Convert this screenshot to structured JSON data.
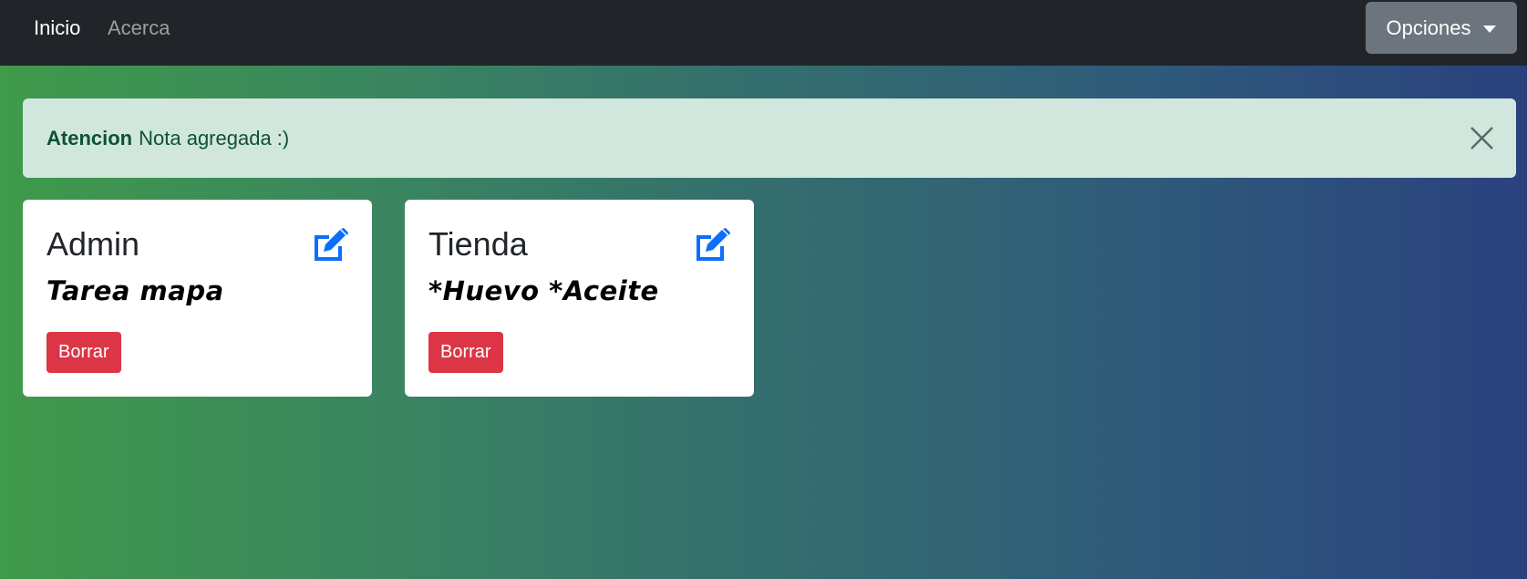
{
  "navbar": {
    "links": [
      {
        "label": "Inicio"
      },
      {
        "label": "Acerca"
      }
    ],
    "options_label": "Opciones"
  },
  "alert": {
    "strong": "Atencion",
    "message": "Nota agregada :)"
  },
  "notes": [
    {
      "title": "Admin",
      "text": "Tarea mapa",
      "delete_label": "Borrar"
    },
    {
      "title": "Tienda",
      "text": "*Huevo *Aceite",
      "delete_label": "Borrar"
    }
  ],
  "colors": {
    "navbar": "#212529",
    "alert_bg": "#d1e7dd",
    "alert_text": "#0f5132",
    "edit_icon": "#0d6efd",
    "danger": "#dc3545",
    "secondary": "#6c757d"
  },
  "icons": {
    "edit": "edit-icon",
    "close": "close-icon",
    "caret": "caret-down-icon"
  }
}
